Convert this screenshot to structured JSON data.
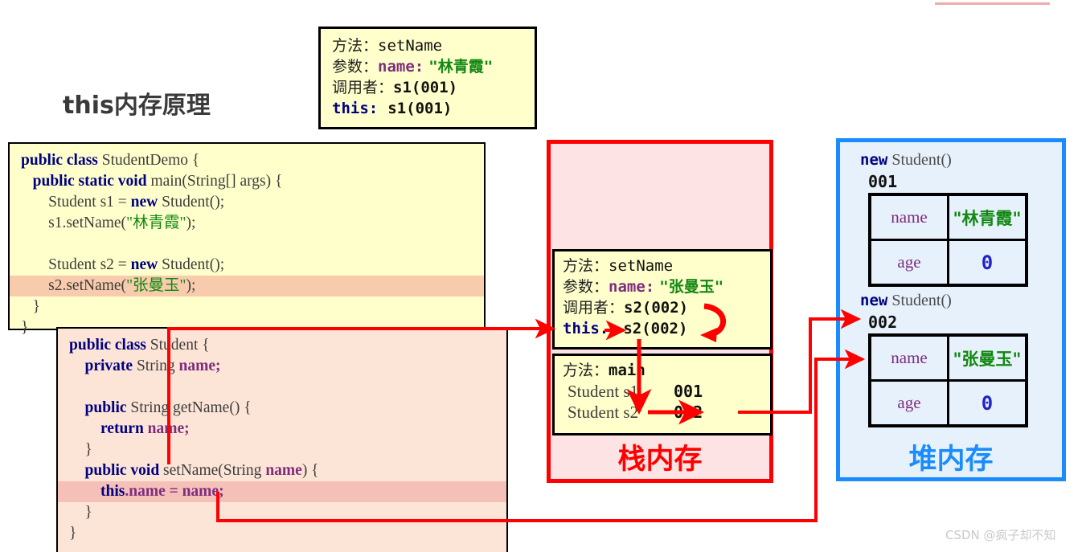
{
  "page_title": "this内存原理",
  "watermark": "CSDN @疯子却不知",
  "note_top": {
    "label_method": "方法：",
    "value_method": "setName",
    "label_param": "参数：",
    "param_name": "name:",
    "param_value": "\"林青霞\"",
    "label_caller": "调用者：",
    "caller_value": "s1(001)",
    "label_this": "this:",
    "this_value": "s1(001)"
  },
  "code_demo": {
    "lines": [
      "public class StudentDemo {",
      "   public static void main(String[] args) {",
      "       Student s1 = new Student();",
      "       s1.setName(\"林青霞\");",
      "",
      "       Student s2 = new Student();",
      "       s2.setName(\"张曼玉\");",
      "   }",
      "}"
    ],
    "highlighted_line": "s2.setName(\"张曼玉\");"
  },
  "code_student": {
    "lines": [
      "public class Student {",
      "    private String name;",
      "",
      "    public String getName() {",
      "        return name;",
      "    }",
      "    public void setName(String name) {",
      "        this.name = name;",
      "    }",
      "}"
    ],
    "highlighted_line": "this.name = name;"
  },
  "stack": {
    "label": "栈内存",
    "frame_setname": {
      "label_method": "方法：",
      "value_method": "setName",
      "label_param": "参数：",
      "param_name": "name:",
      "param_value": "\"张曼玉\"",
      "label_caller": "调用者：",
      "caller_value": "s2(002)",
      "label_this": "this.",
      "this_value": "s2(002)"
    },
    "frame_main": {
      "label_method": "方法：",
      "value_method": "main",
      "vars": [
        {
          "decl": "Student s1",
          "addr": "001"
        },
        {
          "decl": "Student s2",
          "addr": "002"
        }
      ]
    }
  },
  "heap": {
    "label": "堆内存",
    "objects": [
      {
        "new_kw": "new",
        "new_type": "Student()",
        "address": "001",
        "fields": [
          {
            "name": "name",
            "value": "\"林青霞\"",
            "kind": "string"
          },
          {
            "name": "age",
            "value": "0",
            "kind": "number"
          }
        ]
      },
      {
        "new_kw": "new",
        "new_type": "Student()",
        "address": "002",
        "fields": [
          {
            "name": "name",
            "value": "\"张曼玉\"",
            "kind": "string"
          },
          {
            "name": "age",
            "value": "0",
            "kind": "number"
          }
        ]
      }
    ]
  },
  "colors": {
    "stack_border": "#ff0000",
    "stack_fill": "#fde3e3",
    "heap_border": "#1a8cff",
    "heap_fill": "#e7f1fb",
    "note_fill": "#ffffcc",
    "student_code_fill": "#fce4d6",
    "arrow": "#ff0000"
  }
}
